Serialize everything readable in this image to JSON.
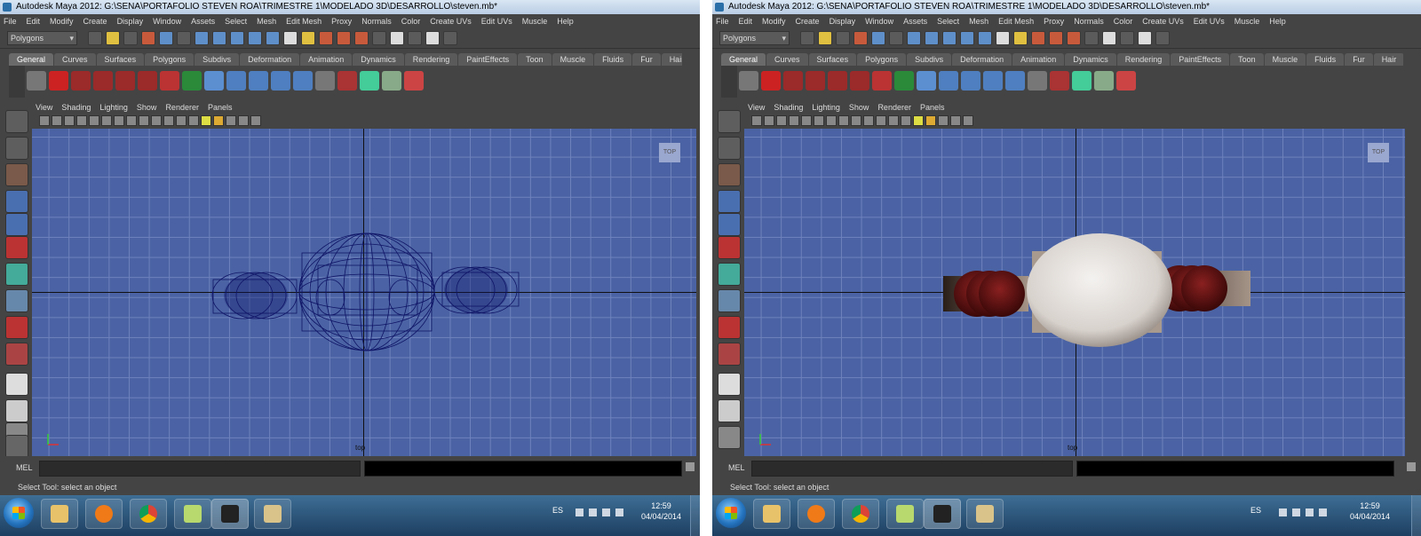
{
  "window": {
    "title": "Autodesk Maya 2012: G:\\SENA\\PORTAFOLIO STEVEN ROA\\TRIMESTRE 1\\MODELADO 3D\\DESARROLLO\\steven.mb*"
  },
  "menus": [
    "File",
    "Edit",
    "Modify",
    "Create",
    "Display",
    "Window",
    "Assets",
    "Select",
    "Mesh",
    "Edit Mesh",
    "Proxy",
    "Normals",
    "Color",
    "Create UVs",
    "Edit UVs",
    "Muscle",
    "Help"
  ],
  "mode_select": {
    "value": "Polygons"
  },
  "shelf_tabs": [
    "General",
    "Curves",
    "Surfaces",
    "Polygons",
    "Subdivs",
    "Deformation",
    "Animation",
    "Dynamics",
    "Rendering",
    "PaintEffects",
    "Toon",
    "Muscle",
    "Fluids",
    "Fur",
    "Hair"
  ],
  "shelf_active_tab": "General",
  "panel_menu": [
    "View",
    "Shading",
    "Lighting",
    "Show",
    "Renderer",
    "Panels"
  ],
  "viewport": {
    "camera": "top",
    "view_cube_label": "TOP"
  },
  "command_line": {
    "label": "MEL"
  },
  "help_line": {
    "text": "Select Tool: select an object"
  },
  "taskbar": {
    "language": "ES",
    "time": "12:59",
    "date": "04/04/2014"
  },
  "colors": {
    "viewport_bg": "#4b63a4",
    "grid": "#6e82bd",
    "wireframe": "#0f1466",
    "body_shaded": "#e6e2df",
    "hands_shaded": "#6a1414"
  }
}
